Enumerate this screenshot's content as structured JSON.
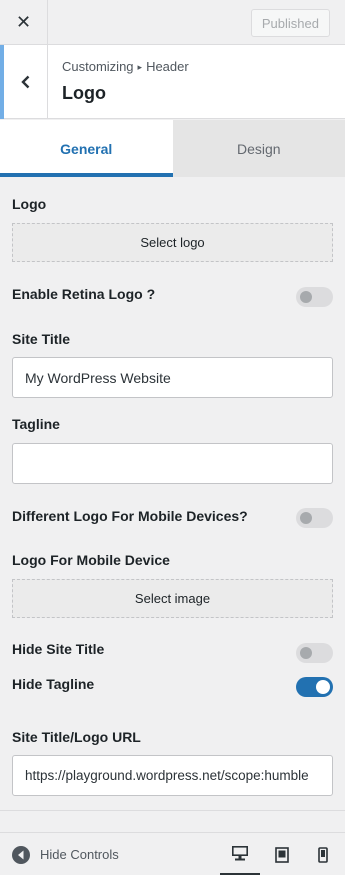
{
  "topbar": {
    "close_symbol": "✕",
    "publish_label": "Published"
  },
  "section": {
    "breadcrumb_root": "Customizing",
    "breadcrumb_arrow": "▸",
    "breadcrumb_parent": "Header",
    "title": "Logo"
  },
  "tabs": {
    "general": "General",
    "design": "Design"
  },
  "controls": {
    "logo_label": "Logo",
    "select_logo": "Select logo",
    "retina_label": "Enable Retina Logo ?",
    "retina_on": false,
    "site_title_label": "Site Title",
    "site_title_value": "My WordPress Website",
    "tagline_label": "Tagline",
    "tagline_value": "",
    "mobile_logo_toggle_label": "Different Logo For Mobile Devices?",
    "mobile_logo_on": false,
    "mobile_logo_label": "Logo For Mobile Device",
    "select_image": "Select image",
    "hide_title_label": "Hide Site Title",
    "hide_title_on": false,
    "hide_tagline_label": "Hide Tagline",
    "hide_tagline_on": true,
    "url_label": "Site Title/Logo URL",
    "url_value": "https://playground.wordpress.net/scope:humble"
  },
  "footer": {
    "hide_controls": "Hide Controls",
    "active_device": "desktop"
  },
  "colors": {
    "accent": "#2271b1",
    "back_bar": "#72aee6"
  }
}
